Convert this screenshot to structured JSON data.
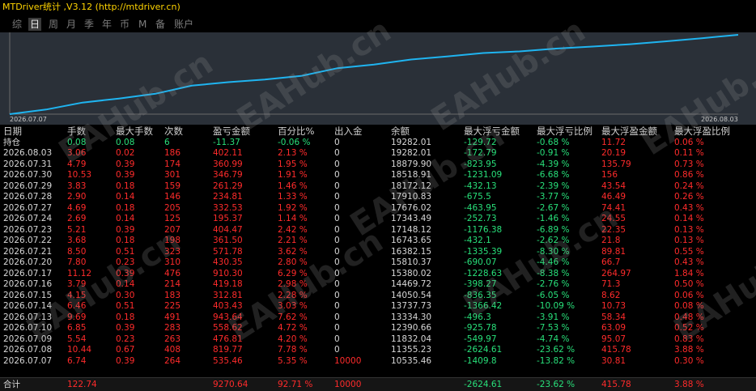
{
  "window": {
    "title": "MTDriver统计 ,V3.12 (http://mtdriver.cn)"
  },
  "tabs": [
    "综",
    "日",
    "周",
    "月",
    "季",
    "年",
    "币",
    "M",
    "备",
    "账户"
  ],
  "active_tab": "日",
  "chart": {
    "start_label": "2026.07.07",
    "end_label": "2026.08.03",
    "line_color": "#1fb4f0",
    "background": "#2a3038"
  },
  "watermark": "EAHub.cn",
  "columns": [
    "日期",
    "手数",
    "最大手数",
    "次数",
    "盈亏金额",
    "百分比%",
    "出入金",
    "余额",
    "最大浮亏金额",
    "最大浮亏比例",
    "最大浮盈金额",
    "最大浮盈比例"
  ],
  "holding": [
    "持仓",
    "0.08",
    "0.08",
    "6",
    "-11.37",
    "-0.06 %",
    "0",
    "19282.01",
    "-129.72",
    "-0.68 %",
    "11.72",
    "0.06 %"
  ],
  "rows": [
    [
      "2026.08.03",
      "3.06",
      "0.02",
      "186",
      "402.11",
      "2.13 %",
      "0",
      "19282.01",
      "-172.79",
      "-0.91 %",
      "20.19",
      "0.11 %"
    ],
    [
      "2026.07.31",
      "4.79",
      "0.39",
      "174",
      "360.99",
      "1.95 %",
      "0",
      "18879.90",
      "-823.95",
      "-4.39 %",
      "135.79",
      "0.73 %"
    ],
    [
      "2026.07.30",
      "10.53",
      "0.39",
      "301",
      "346.79",
      "1.91 %",
      "0",
      "18518.91",
      "-1231.09",
      "-6.68 %",
      "156",
      "0.86 %"
    ],
    [
      "2026.07.29",
      "3.83",
      "0.18",
      "159",
      "261.29",
      "1.46 %",
      "0",
      "18172.12",
      "-432.13",
      "-2.39 %",
      "43.54",
      "0.24 %"
    ],
    [
      "2026.07.28",
      "2.90",
      "0.14",
      "146",
      "234.81",
      "1.33 %",
      "0",
      "17910.83",
      "-675.5",
      "-3.77 %",
      "46.49",
      "0.26 %"
    ],
    [
      "2026.07.27",
      "4.69",
      "0.18",
      "205",
      "332.53",
      "1.92 %",
      "0",
      "17676.02",
      "-463.95",
      "-2.67 %",
      "74.41",
      "0.43 %"
    ],
    [
      "2026.07.24",
      "2.69",
      "0.14",
      "125",
      "195.37",
      "1.14 %",
      "0",
      "17343.49",
      "-252.73",
      "-1.46 %",
      "24.55",
      "0.14 %"
    ],
    [
      "2026.07.23",
      "5.21",
      "0.39",
      "207",
      "404.47",
      "2.42 %",
      "0",
      "17148.12",
      "-1176.38",
      "-6.89 %",
      "22.35",
      "0.13 %"
    ],
    [
      "2026.07.22",
      "3.68",
      "0.18",
      "198",
      "361.50",
      "2.21 %",
      "0",
      "16743.65",
      "-432.1",
      "-2.62 %",
      "21.8",
      "0.13 %"
    ],
    [
      "2026.07.21",
      "8.50",
      "0.51",
      "323",
      "571.78",
      "3.62 %",
      "0",
      "16382.15",
      "-1335.39",
      "-8.30 %",
      "89.81",
      "0.55 %"
    ],
    [
      "2026.07.20",
      "7.80",
      "0.23",
      "310",
      "430.35",
      "2.80 %",
      "0",
      "15810.37",
      "-690.07",
      "-4.46 %",
      "66.7",
      "0.43 %"
    ],
    [
      "2026.07.17",
      "11.12",
      "0.39",
      "476",
      "910.30",
      "6.29 %",
      "0",
      "15380.02",
      "-1228.63",
      "-8.38 %",
      "264.97",
      "1.84 %"
    ],
    [
      "2026.07.16",
      "3.79",
      "0.14",
      "214",
      "419.18",
      "2.98 %",
      "0",
      "14469.72",
      "-398.27",
      "-2.76 %",
      "71.3",
      "0.50 %"
    ],
    [
      "2026.07.15",
      "4.15",
      "0.30",
      "183",
      "312.81",
      "2.28 %",
      "0",
      "14050.54",
      "-836.35",
      "-6.05 %",
      "8.62",
      "0.06 %"
    ],
    [
      "2026.07.14",
      "6.46",
      "0.51",
      "225",
      "403.43",
      "3.03 %",
      "0",
      "13737.73",
      "-1366.42",
      "-10.09 %",
      "10.73",
      "0.08 %"
    ],
    [
      "2026.07.13",
      "9.69",
      "0.18",
      "491",
      "943.64",
      "7.62 %",
      "0",
      "13334.30",
      "-496.3",
      "-3.91 %",
      "58.34",
      "0.48 %"
    ],
    [
      "2026.07.10",
      "6.85",
      "0.39",
      "283",
      "558.62",
      "4.72 %",
      "0",
      "12390.66",
      "-925.78",
      "-7.53 %",
      "63.09",
      "0.52 %"
    ],
    [
      "2026.07.09",
      "5.54",
      "0.23",
      "263",
      "476.81",
      "4.20 %",
      "0",
      "11832.04",
      "-549.97",
      "-4.74 %",
      "95.07",
      "0.83 %"
    ],
    [
      "2026.07.08",
      "10.44",
      "0.67",
      "408",
      "819.77",
      "7.78 %",
      "0",
      "11355.23",
      "-2624.61",
      "-23.62 %",
      "415.78",
      "3.88 %"
    ],
    [
      "2026.07.07",
      "6.74",
      "0.39",
      "264",
      "535.46",
      "5.35 %",
      "10000",
      "10535.46",
      "-1409.8",
      "-13.82 %",
      "30.81",
      "0.30 %"
    ]
  ],
  "total": [
    "合计",
    "122.74",
    "",
    "",
    "9270.64",
    "92.71 %",
    "10000",
    "",
    "-2624.61",
    "-23.62 %",
    "415.78",
    "3.88 %"
  ],
  "colors": {
    "positive": "#ff2b2b",
    "negative": "#28e07a",
    "title": "#ffd400"
  }
}
